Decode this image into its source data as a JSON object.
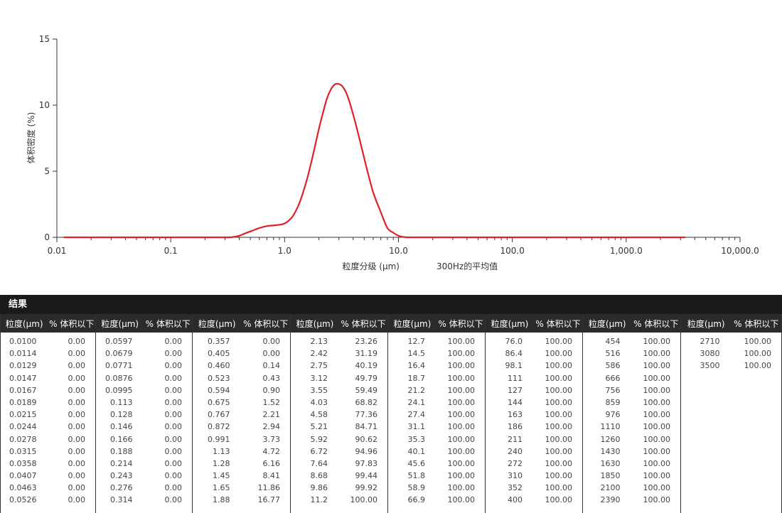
{
  "chart_data": {
    "type": "line",
    "ylabel": "体积密度 (%)",
    "xlabel": "粒度分级 (μm)",
    "xlabel_suffix": "300Hz的平均值",
    "xscale": "log",
    "xlim": [
      0.01,
      10000
    ],
    "ylim": [
      0,
      15
    ],
    "xticks": [
      0.01,
      0.1,
      1.0,
      10.0,
      100.0,
      1000.0,
      10000.0
    ],
    "xtick_labels": [
      "0.01",
      "0.1",
      "1.0",
      "10.0",
      "100.0",
      "1,000.0",
      "10,000.0"
    ],
    "yticks": [
      0,
      5,
      10,
      15
    ],
    "ytick_labels": [
      "0",
      "5",
      "10",
      "15"
    ],
    "grid": false,
    "color": "#e0202a",
    "series": [
      {
        "x": [
          0.0115,
          0.1,
          0.3,
          0.35,
          0.4,
          0.45,
          0.52,
          0.6,
          0.7,
          0.8,
          0.9,
          1.0,
          1.1,
          1.2,
          1.35,
          1.55,
          1.75,
          2.0,
          2.2,
          2.4,
          2.7,
          3.0,
          3.3,
          3.6,
          4.0,
          4.5,
          5.2,
          6.0,
          7.0,
          8.0,
          9.0,
          10.0,
          11.0,
          12.0,
          15.0,
          50.0,
          500.0,
          3300.0
        ],
        "y": [
          0,
          0,
          0,
          0.02,
          0.12,
          0.3,
          0.5,
          0.7,
          0.85,
          0.9,
          0.95,
          1.05,
          1.3,
          1.7,
          2.6,
          4.2,
          6.0,
          8.2,
          9.6,
          10.7,
          11.5,
          11.6,
          11.3,
          10.6,
          9.3,
          7.6,
          5.4,
          3.4,
          1.9,
          0.7,
          0.35,
          0.12,
          0.03,
          0,
          0,
          0,
          0,
          0
        ]
      }
    ]
  },
  "results": {
    "title": "结果",
    "col_size": "粒度(μm)",
    "col_pct": "% 体积以下",
    "groups": [
      {
        "rows": [
          [
            "0.0100",
            "0.00"
          ],
          [
            "0.0114",
            "0.00"
          ],
          [
            "0.0129",
            "0.00"
          ],
          [
            "0.0147",
            "0.00"
          ],
          [
            "0.0167",
            "0.00"
          ],
          [
            "0.0189",
            "0.00"
          ],
          [
            "0.0215",
            "0.00"
          ],
          [
            "0.0244",
            "0.00"
          ],
          [
            "0.0278",
            "0.00"
          ],
          [
            "0.0315",
            "0.00"
          ],
          [
            "0.0358",
            "0.00"
          ],
          [
            "0.0407",
            "0.00"
          ],
          [
            "0.0463",
            "0.00"
          ],
          [
            "0.0526",
            "0.00"
          ]
        ]
      },
      {
        "rows": [
          [
            "0.0597",
            "0.00"
          ],
          [
            "0.0679",
            "0.00"
          ],
          [
            "0.0771",
            "0.00"
          ],
          [
            "0.0876",
            "0.00"
          ],
          [
            "0.0995",
            "0.00"
          ],
          [
            "0.113",
            "0.00"
          ],
          [
            "0.128",
            "0.00"
          ],
          [
            "0.146",
            "0.00"
          ],
          [
            "0.166",
            "0.00"
          ],
          [
            "0.188",
            "0.00"
          ],
          [
            "0.214",
            "0.00"
          ],
          [
            "0.243",
            "0.00"
          ],
          [
            "0.276",
            "0.00"
          ],
          [
            "0.314",
            "0.00"
          ]
        ]
      },
      {
        "rows": [
          [
            "0.357",
            "0.00"
          ],
          [
            "0.405",
            "0.00"
          ],
          [
            "0.460",
            "0.14"
          ],
          [
            "0.523",
            "0.43"
          ],
          [
            "0.594",
            "0.90"
          ],
          [
            "0.675",
            "1.52"
          ],
          [
            "0.767",
            "2.21"
          ],
          [
            "0.872",
            "2.94"
          ],
          [
            "0.991",
            "3.73"
          ],
          [
            "1.13",
            "4.72"
          ],
          [
            "1.28",
            "6.16"
          ],
          [
            "1.45",
            "8.41"
          ],
          [
            "1.65",
            "11.86"
          ],
          [
            "1.88",
            "16.77"
          ]
        ]
      },
      {
        "rows": [
          [
            "2.13",
            "23.26"
          ],
          [
            "2.42",
            "31.19"
          ],
          [
            "2.75",
            "40.19"
          ],
          [
            "3.12",
            "49.79"
          ],
          [
            "3.55",
            "59.49"
          ],
          [
            "4.03",
            "68.82"
          ],
          [
            "4.58",
            "77.36"
          ],
          [
            "5.21",
            "84.71"
          ],
          [
            "5.92",
            "90.62"
          ],
          [
            "6.72",
            "94.96"
          ],
          [
            "7.64",
            "97.83"
          ],
          [
            "8.68",
            "99.44"
          ],
          [
            "9.86",
            "99.92"
          ],
          [
            "11.2",
            "100.00"
          ]
        ]
      },
      {
        "rows": [
          [
            "12.7",
            "100.00"
          ],
          [
            "14.5",
            "100.00"
          ],
          [
            "16.4",
            "100.00"
          ],
          [
            "18.7",
            "100.00"
          ],
          [
            "21.2",
            "100.00"
          ],
          [
            "24.1",
            "100.00"
          ],
          [
            "27.4",
            "100.00"
          ],
          [
            "31.1",
            "100.00"
          ],
          [
            "35.3",
            "100.00"
          ],
          [
            "40.1",
            "100.00"
          ],
          [
            "45.6",
            "100.00"
          ],
          [
            "51.8",
            "100.00"
          ],
          [
            "58.9",
            "100.00"
          ],
          [
            "66.9",
            "100.00"
          ]
        ]
      },
      {
        "rows": [
          [
            "76.0",
            "100.00"
          ],
          [
            "86.4",
            "100.00"
          ],
          [
            "98.1",
            "100.00"
          ],
          [
            "111",
            "100.00"
          ],
          [
            "127",
            "100.00"
          ],
          [
            "144",
            "100.00"
          ],
          [
            "163",
            "100.00"
          ],
          [
            "186",
            "100.00"
          ],
          [
            "211",
            "100.00"
          ],
          [
            "240",
            "100.00"
          ],
          [
            "272",
            "100.00"
          ],
          [
            "310",
            "100.00"
          ],
          [
            "352",
            "100.00"
          ],
          [
            "400",
            "100.00"
          ]
        ]
      },
      {
        "rows": [
          [
            "454",
            "100.00"
          ],
          [
            "516",
            "100.00"
          ],
          [
            "586",
            "100.00"
          ],
          [
            "666",
            "100.00"
          ],
          [
            "756",
            "100.00"
          ],
          [
            "859",
            "100.00"
          ],
          [
            "976",
            "100.00"
          ],
          [
            "1110",
            "100.00"
          ],
          [
            "1260",
            "100.00"
          ],
          [
            "1430",
            "100.00"
          ],
          [
            "1630",
            "100.00"
          ],
          [
            "1850",
            "100.00"
          ],
          [
            "2100",
            "100.00"
          ],
          [
            "2390",
            "100.00"
          ]
        ]
      },
      {
        "rows": [
          [
            "2710",
            "100.00"
          ],
          [
            "3080",
            "100.00"
          ],
          [
            "3500",
            "100.00"
          ]
        ]
      }
    ]
  }
}
